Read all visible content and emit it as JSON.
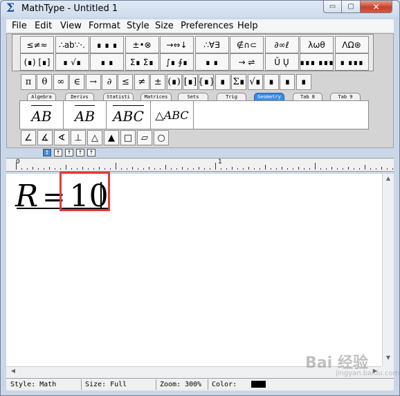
{
  "window": {
    "title": "MathType - Untitled 1",
    "icon": "sigma-icon",
    "controls": {
      "minimize": "▭",
      "maximize": "▢",
      "close": "✕"
    }
  },
  "menu": [
    {
      "label": "File"
    },
    {
      "label": "Edit"
    },
    {
      "label": "View"
    },
    {
      "label": "Format"
    },
    {
      "label": "Style"
    },
    {
      "label": "Size"
    },
    {
      "label": "Preferences"
    },
    {
      "label": "Help"
    }
  ],
  "palettes": {
    "row1": [
      "≤≠≈",
      "∴ab∵·.",
      "∎ ∎ ∎",
      "±•⊗",
      "→⇔↓",
      "∴∀∃",
      "∉∩⊂",
      "∂∞ℓ",
      "λωθ",
      "ΛΩ⊛"
    ],
    "row2": [
      "(∎) [∎]",
      "∎ √∎",
      "∎ ∎",
      "Σ∎ Σ∎",
      "∫∎ ∮∎",
      "∎ ∎",
      "→ ⇌",
      "Ū Ų",
      "∎∎∎ ∎∎∎",
      "∎ ∎∎∎"
    ]
  },
  "symbols": [
    "π",
    "θ",
    "∞",
    "∈",
    "→",
    "∂",
    "≤",
    "≠",
    "±",
    "(∎)",
    "[∎]",
    "{∎}",
    "∎",
    "Σ∎",
    "√∎",
    "∎",
    "∎",
    "∎"
  ],
  "tabs": [
    {
      "label": "Algebra",
      "active": false
    },
    {
      "label": "Derivs",
      "active": false
    },
    {
      "label": "Statisti",
      "active": false
    },
    {
      "label": "Matrices",
      "active": false
    },
    {
      "label": "Sets",
      "active": false
    },
    {
      "label": "Trig",
      "active": false
    },
    {
      "label": "Geometry",
      "active": true
    },
    {
      "label": "Tab 8",
      "active": false
    },
    {
      "label": "Tab 9",
      "active": false
    }
  ],
  "templates": [
    "AB",
    "AB",
    "ABC",
    "△ABC"
  ],
  "geometry_symbols": [
    "∠",
    "∡",
    "∢",
    "⊥",
    "△",
    "▲",
    "□",
    "▱",
    "○"
  ],
  "nudge": [
    "↕",
    "↑",
    "↑",
    "↑",
    "↑"
  ],
  "ruler": {
    "labels": [
      "0",
      "1"
    ]
  },
  "equation": {
    "lhs": "R",
    "op": "=",
    "rhs": "10"
  },
  "status": {
    "style": "Style: Math",
    "size": "Size: Full",
    "zoom": "Zoom: 300%",
    "color_label": "Color:",
    "color_value": "#000000"
  },
  "watermark": {
    "main": "Bai 经验",
    "sub": "jingyan.baidu.com"
  }
}
